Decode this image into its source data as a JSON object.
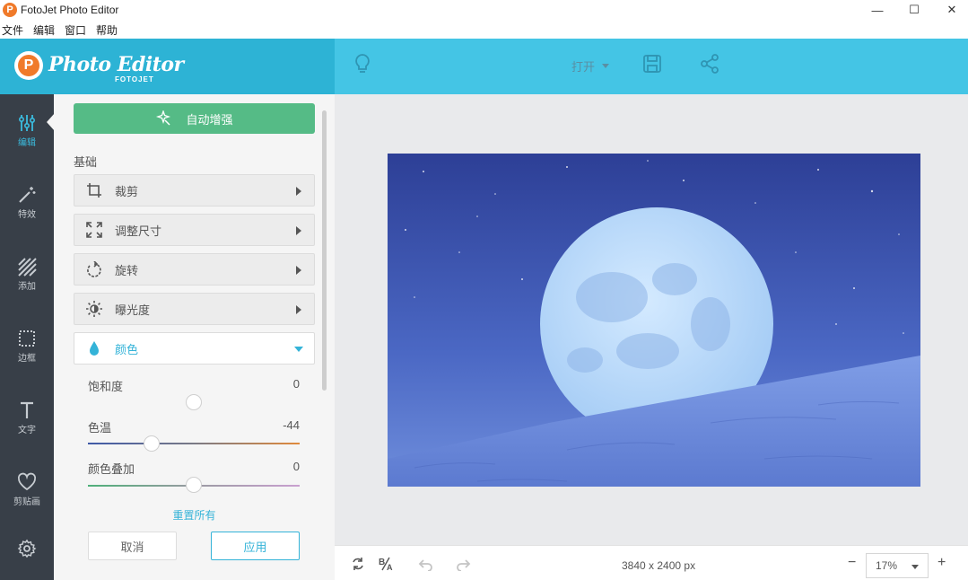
{
  "window": {
    "title": "FotoJet Photo Editor",
    "minimize": "—",
    "maximize": "☐",
    "close": "✕"
  },
  "menu": [
    "文件",
    "编辑",
    "窗口",
    "帮助"
  ],
  "header": {
    "logo_text": "Photo Editor",
    "logo_sub": "FOTOJET",
    "open_label": "打开"
  },
  "nav": [
    {
      "label": "编辑",
      "icon": "sliders-icon",
      "active": true
    },
    {
      "label": "特效",
      "icon": "magic-wand-icon",
      "active": false
    },
    {
      "label": "添加",
      "icon": "hatch-icon",
      "active": false
    },
    {
      "label": "边框",
      "icon": "frame-icon",
      "active": false
    },
    {
      "label": "文字",
      "icon": "text-icon",
      "active": false
    },
    {
      "label": "剪贴画",
      "icon": "heart-icon",
      "active": false
    },
    {
      "label": "",
      "icon": "gear-icon",
      "active": false
    }
  ],
  "panel": {
    "auto_enhance": "自动增强",
    "section_basic": "基础",
    "rows": [
      {
        "label": "裁剪",
        "icon": "crop-icon"
      },
      {
        "label": "调整尺寸",
        "icon": "resize-icon"
      },
      {
        "label": "旋转",
        "icon": "rotate-icon"
      },
      {
        "label": "曝光度",
        "icon": "exposure-icon"
      },
      {
        "label": "颜色",
        "icon": "droplet-icon",
        "open": true
      }
    ],
    "sliders": [
      {
        "label": "饱和度",
        "value": "0",
        "level": 0.5
      },
      {
        "label": "色温",
        "value": "-44",
        "level": 0.3
      },
      {
        "label": "颜色叠加",
        "value": "0",
        "level": 0.5
      }
    ],
    "reset_all": "重置所有",
    "cancel": "取消",
    "apply": "应用"
  },
  "bottom": {
    "dimension": "3840 x 2400 px",
    "zoom": "17%",
    "zoom_minus": "−",
    "zoom_plus": "+"
  },
  "colors": {
    "header_left": "#2db3d5",
    "header_right": "#44c5e5",
    "nav_bg": "#383f48",
    "accent": "#34b3d8",
    "green": "#55bb86"
  }
}
